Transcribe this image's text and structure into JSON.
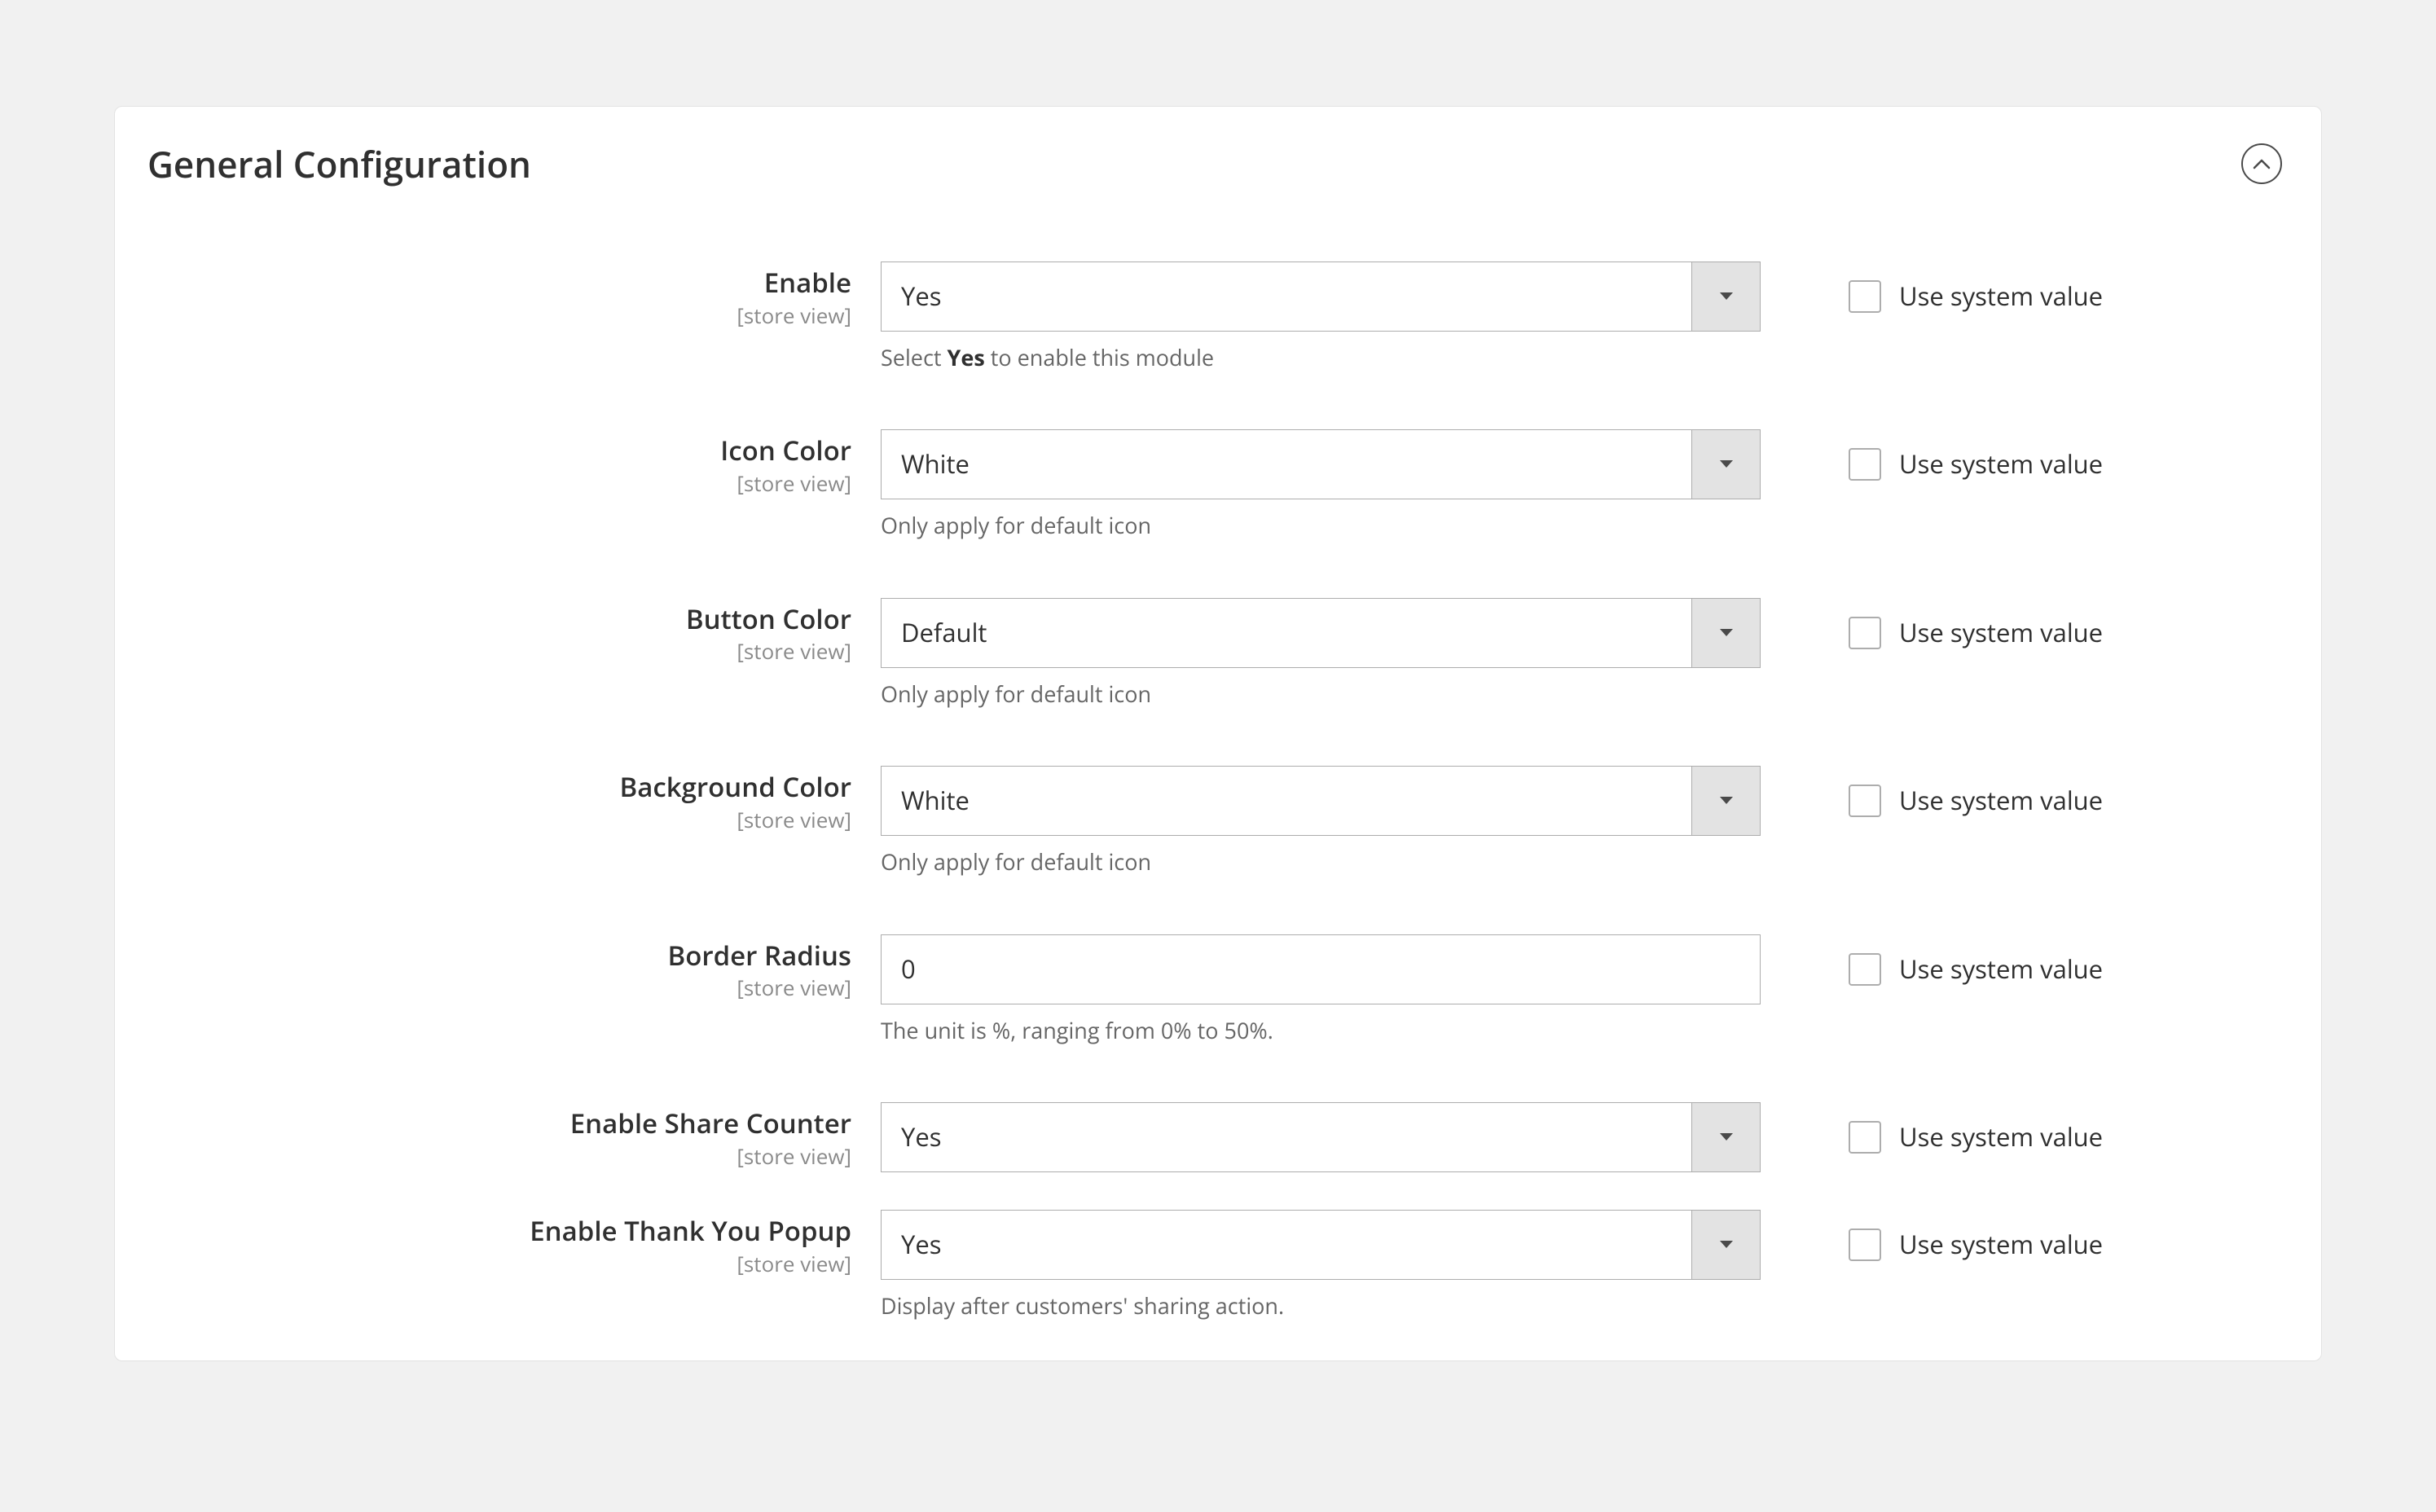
{
  "panel": {
    "title": "General Configuration",
    "scope_label": "[store view]",
    "system_value_label": "Use system value"
  },
  "fields": {
    "enable": {
      "label": "Enable",
      "value": "Yes",
      "hint_pre": "Select ",
      "hint_bold": "Yes",
      "hint_post": " to enable this module"
    },
    "icon_color": {
      "label": "Icon Color",
      "value": "White",
      "hint": "Only apply for default icon"
    },
    "button_color": {
      "label": "Button Color",
      "value": "Default",
      "hint": "Only apply for default icon"
    },
    "background_color": {
      "label": "Background Color",
      "value": "White",
      "hint": "Only apply for default icon"
    },
    "border_radius": {
      "label": "Border Radius",
      "value": "0",
      "hint": "The unit is %, ranging from 0% to 50%."
    },
    "share_counter": {
      "label": "Enable Share Counter",
      "value": "Yes"
    },
    "thank_you": {
      "label": "Enable Thank You Popup",
      "value": "Yes",
      "hint": "Display after customers' sharing action."
    }
  }
}
